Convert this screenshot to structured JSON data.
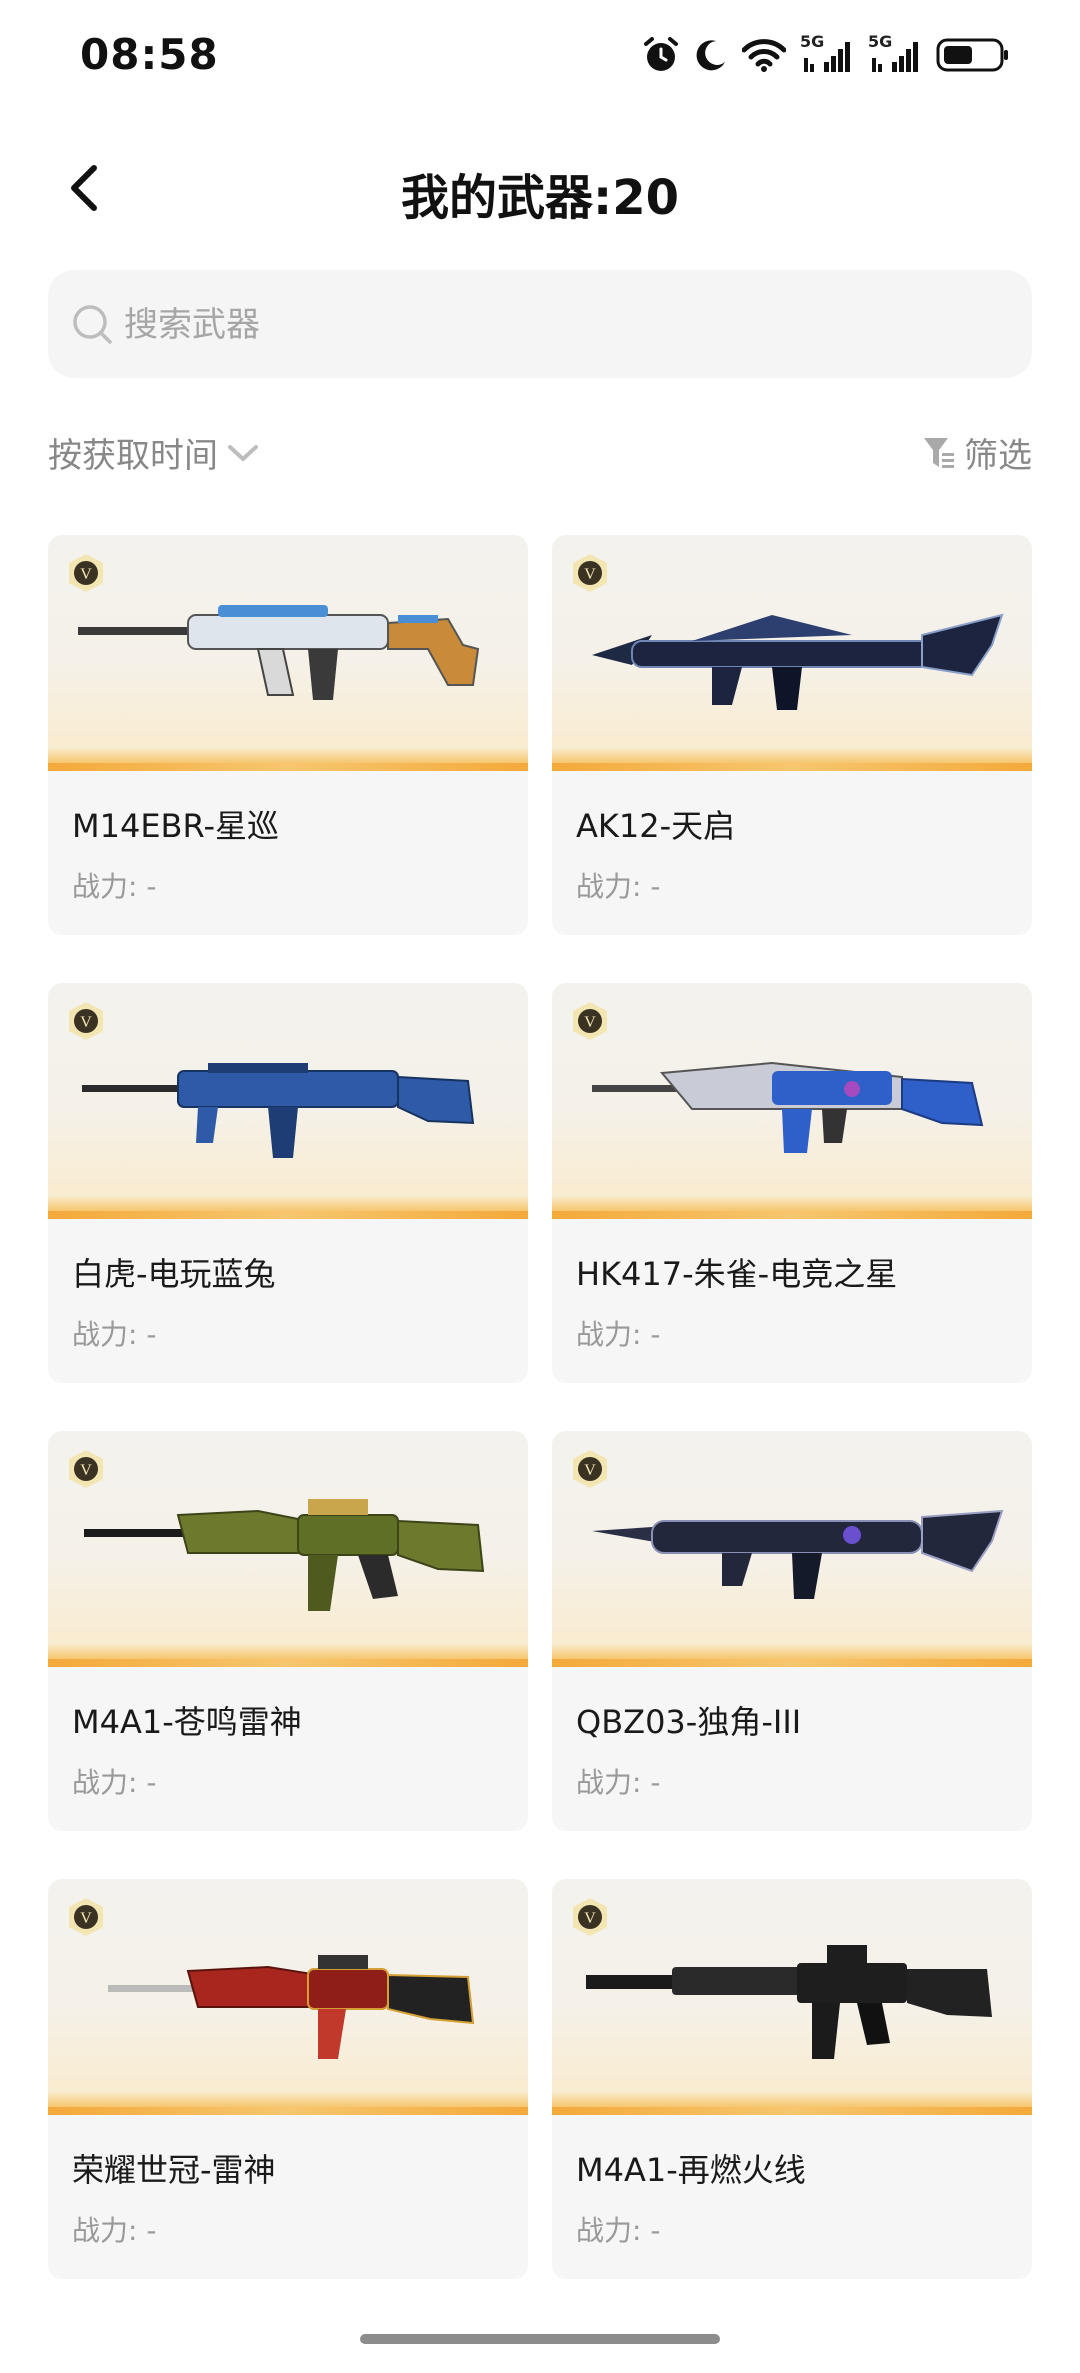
{
  "status_bar": {
    "time": "08:58",
    "net1": "5G",
    "net2": "5G"
  },
  "header": {
    "title": "我的武器:20"
  },
  "search": {
    "placeholder": "搜索武器"
  },
  "sort": {
    "label": "按获取时间"
  },
  "filter": {
    "label": "筛选"
  },
  "weapons": [
    {
      "name": "M14EBR-星巡",
      "power": "战力: -"
    },
    {
      "name": "AK12-天启",
      "power": "战力: -"
    },
    {
      "name": "白虎-电玩蓝兔",
      "power": "战力: -"
    },
    {
      "name": "HK417-朱雀-电竞之星",
      "power": "战力: -"
    },
    {
      "name": "M4A1-苍鸣雷神",
      "power": "战力: -"
    },
    {
      "name": "QBZ03-独角-III",
      "power": "战力: -"
    },
    {
      "name": "荣耀世冠-雷神",
      "power": "战力: -"
    },
    {
      "name": "M4A1-再燃火线",
      "power": "战力: -"
    }
  ],
  "colors": {
    "accent": "#f4a93a",
    "card_bg": "#f6f6f6",
    "muted_text": "#999999"
  },
  "icons": [
    "alarm-icon",
    "moon-icon",
    "wifi-icon",
    "signal-icon",
    "battery-icon",
    "back-arrow-icon",
    "search-icon",
    "chevron-down-icon",
    "filter-icon",
    "v-badge-icon"
  ]
}
